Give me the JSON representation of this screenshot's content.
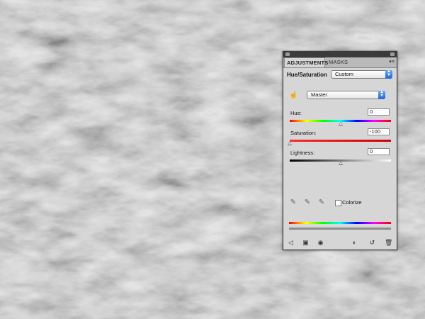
{
  "panel": {
    "tabs": [
      "ADJUSTMENTS",
      "MASKS"
    ],
    "menu_icon": "panel-menu-icon",
    "adjustment_name": "Hue/Saturation",
    "preset": "Custom",
    "channel": "Master",
    "hue": {
      "label": "Hue:",
      "value": "0",
      "level": 0.5
    },
    "saturation": {
      "label": "Saturation:",
      "value": "-100",
      "level": 0.0
    },
    "lightness": {
      "label": "Lightness:",
      "value": "0",
      "level": 0.5
    },
    "colorize_label": "Colorize",
    "colorize_checked": false,
    "tools": [
      "eyedropper-icon",
      "eyedropper-plus-icon",
      "eyedropper-minus-icon"
    ],
    "footer_icons": [
      "back-arrow-icon",
      "clip-to-layer-icon",
      "visibility-eye-icon",
      "view-previous-icon",
      "reset-icon",
      "trash-icon"
    ]
  }
}
